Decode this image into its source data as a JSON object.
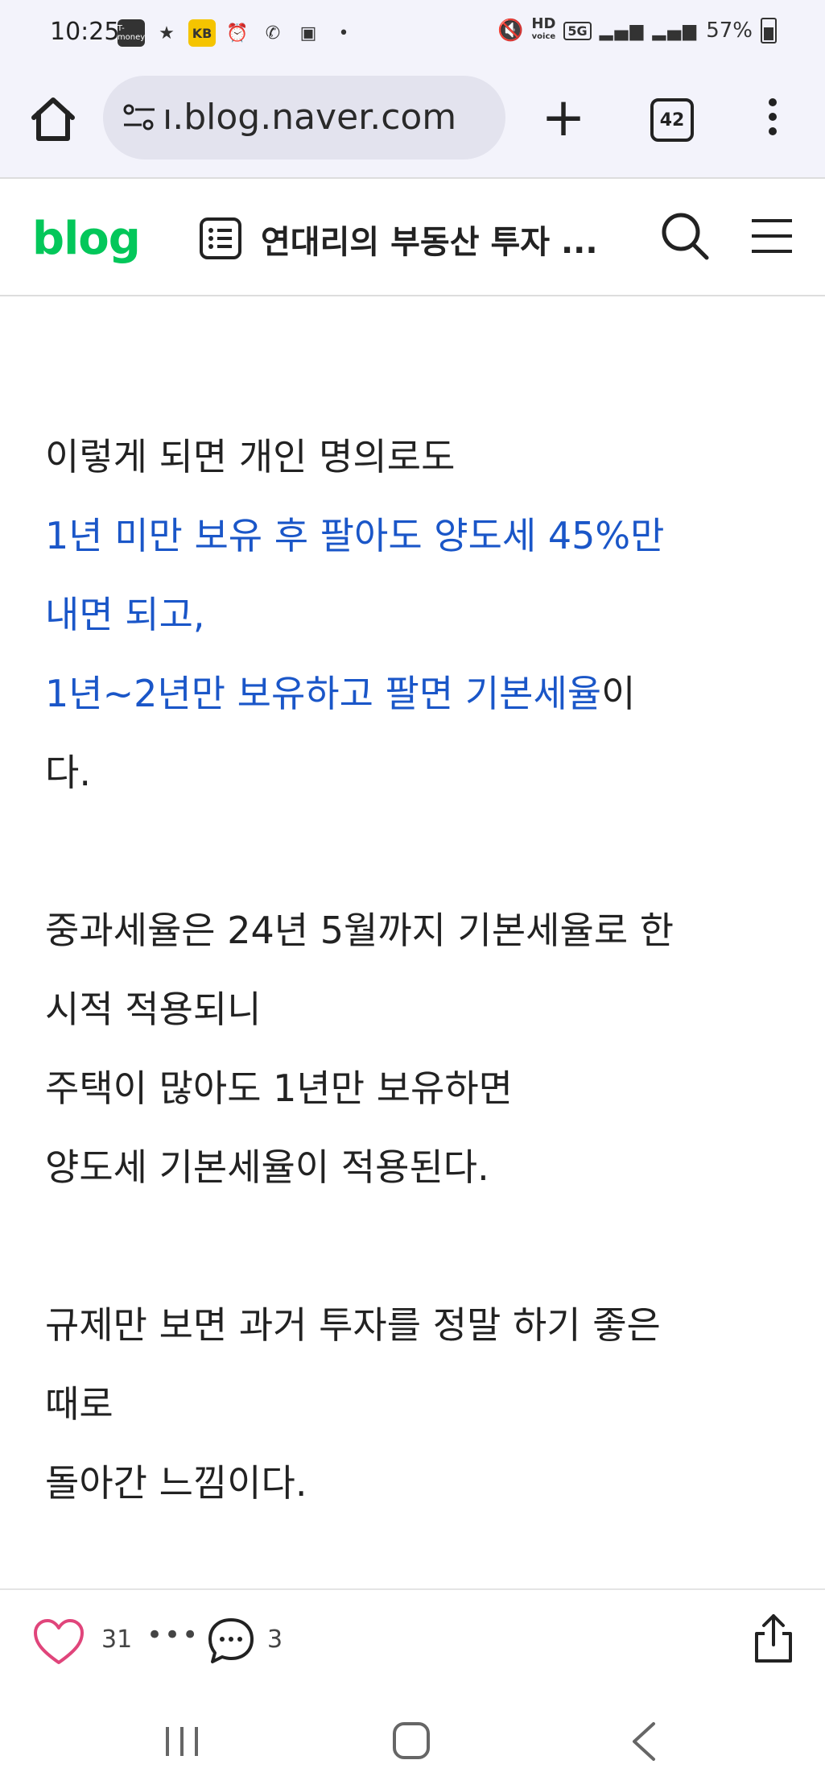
{
  "status_bar": {
    "time": "10:25",
    "tmoney_label": "T-money",
    "kb_label": "KB",
    "hd_label": "HD",
    "voice_label": "voice",
    "network": "5G",
    "battery": "57%",
    "battery_level": 0.57
  },
  "browser": {
    "url": "ı.blog.naver.com",
    "tab_count": "42"
  },
  "blog_header": {
    "logo": "blog",
    "title": "연대리의 부동산 투자 ..."
  },
  "content": {
    "p1_line1": "이렇게 되면 개인 명의로도",
    "p1_line2_blue": "1년 미만 보유 후 팔아도 양도세 45%만",
    "p1_line3_blue": "내면 되고,",
    "p1_line4_blue": "1년~2년만 보유하고 팔면 기본세율",
    "p1_line4_rest": "이",
    "p1_line5": "다.",
    "p2_line1": "중과세율은 24년 5월까지 기본세율로 한",
    "p2_line2": "시적 적용되니",
    "p2_line3": "주택이 많아도 1년만 보유하면",
    "p2_line4": "양도세 기본세율이 적용된다.",
    "p3_line1": "규제만 보면 과거 투자를 정말 하기 좋은",
    "p3_line2": "때로",
    "p3_line3": "돌아간 느낌이다."
  },
  "actions": {
    "like_count": "31",
    "more": "•••",
    "comment_count": "3"
  },
  "colors": {
    "accent_green": "#03c75a",
    "link_blue": "#1a56c8",
    "heart_pink": "#e0457b"
  }
}
